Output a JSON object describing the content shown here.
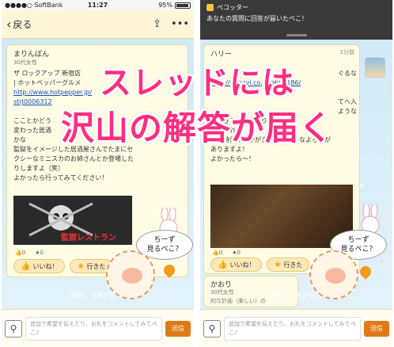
{
  "caption": {
    "line1": "スレッドには",
    "line2": "沢山の解答が届く"
  },
  "left": {
    "status": {
      "carrier": "●●●●○ SoftBank",
      "time": "11:27",
      "battery": "95%"
    },
    "nav": {
      "back_label": "戻る"
    },
    "card": {
      "name": "まりんぼん",
      "age": "30代女性",
      "lines": [
        "ザ ロックアップ 新宿店",
        "| ホットペッパーグルメ",
        "http://www.hotpepper.jp/",
        "strJ0006312",
        "",
        "こことかどう",
        "変わった居酒",
        "かな",
        "監獄をイメージした居酒屋さんでたまにセ",
        "クシーなミニスカのお姉さんとか登場した",
        "りしますよ（笑）",
        "よかったら行ってみてください！"
      ],
      "photo_caption": "監獄レストラン",
      "reaction_like": "0",
      "reaction_star": "0",
      "btn_nice": "いいね！",
      "btn_go": "行きた"
    },
    "footer": "現在、5名が回答",
    "input": {
      "placeholder": "追加で希望を伝えたり、お礼をコメントしてみてペこ♪",
      "send": "送信"
    },
    "bubble": "ちーず\n見るペこ？"
  },
  "right": {
    "notif": {
      "app": "ペコッター",
      "message": "あなたの質問に回答が届いたペこ！"
    },
    "card": {
      "name": "ハリー",
      "time": "1分前",
      "lines": [
        "ぐるな",
        "http://r.gnavi.co.jp/g600186/",
        "",
        "てへ入",
        "ような",
        "ができるお店もあります",
        "かあれれば",
        "戦国時代の人ががきていたようなよろいが",
        "ありますよ！",
        "よかったら〜！"
      ],
      "reaction_like": "0",
      "reaction_star": "0",
      "btn_nice": "いいね！",
      "btn_go": "行きた"
    },
    "second_card": {
      "name": "かおり",
      "age": "30代女性",
      "preview": "的な計画（楽しい）の"
    },
    "footer": "現在、1名が回答",
    "input": {
      "placeholder": "追加で希望を伝えたり、お礼をコメントしてみてペこ♪",
      "send": "送信"
    },
    "bubble": "ちーず\n見るペこ？"
  },
  "colors": {
    "caption": "#ff2e7e",
    "send_button": "#e07a18",
    "link": "#1a4fb8"
  },
  "icons": [
    "back-chevron-icon",
    "share-icon",
    "more-icon",
    "thumb-icon",
    "star-icon",
    "search-icon",
    "map-pin-icon"
  ]
}
